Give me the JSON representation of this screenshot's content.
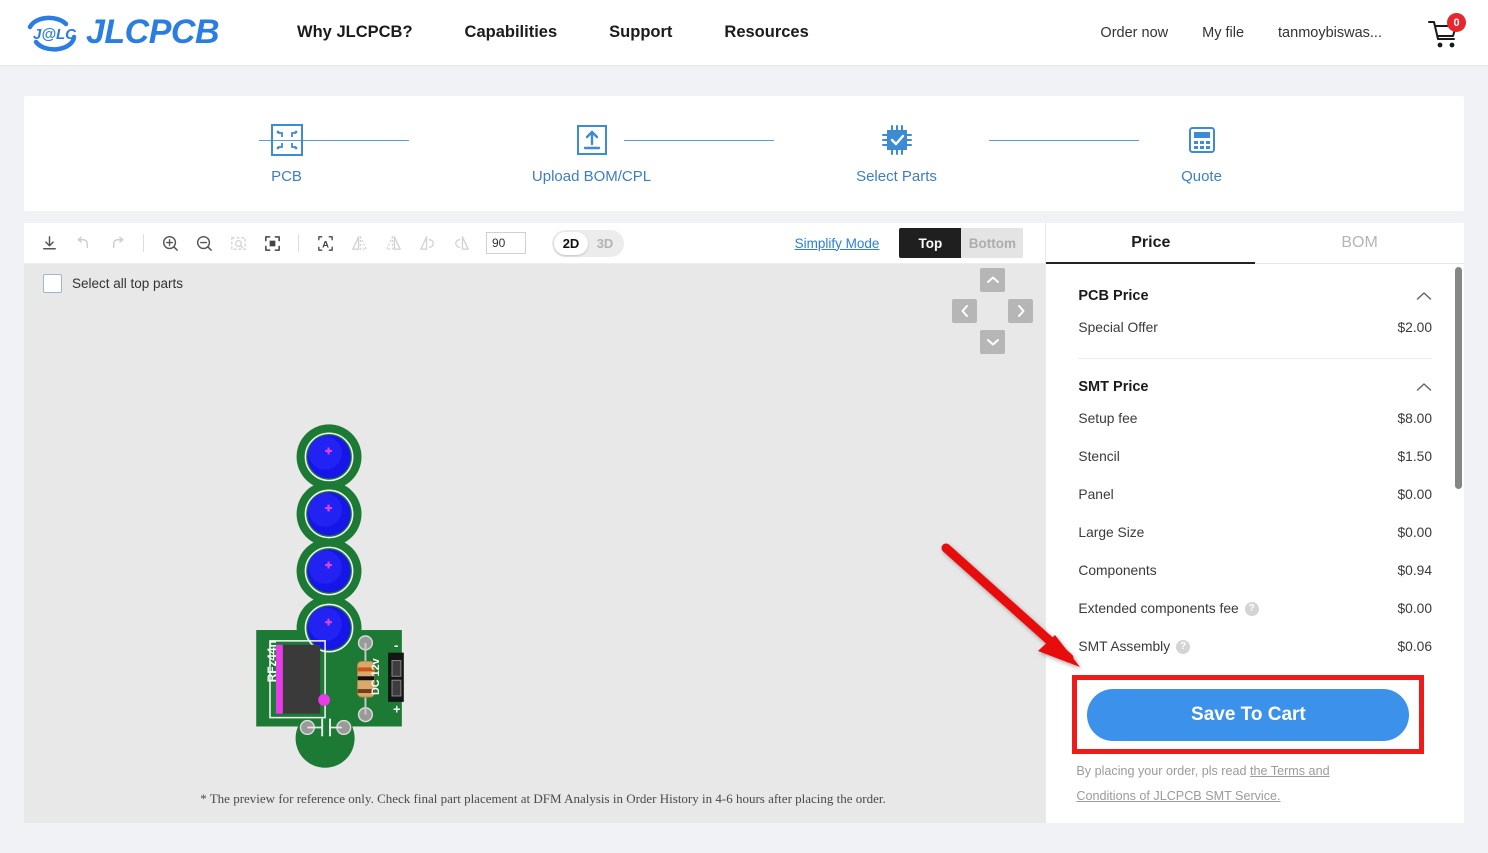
{
  "header": {
    "logo_mark": "jlc-logo-icon",
    "logo_text": "JLCPCB",
    "nav": [
      {
        "label": "Why JLCPCB?"
      },
      {
        "label": "Capabilities"
      },
      {
        "label": "Support"
      },
      {
        "label": "Resources"
      }
    ],
    "right_links": [
      {
        "label": "Order now"
      },
      {
        "label": "My file"
      },
      {
        "label": "tanmoybiswas..."
      }
    ],
    "cart_icon": "shopping-cart-icon",
    "cart_count": "0",
    "cart_badge_color": "#e8262d",
    "brand_color": "#2a7de1"
  },
  "stepper": {
    "steps": [
      {
        "label": "PCB",
        "icon": "pcb-board-icon"
      },
      {
        "label": "Upload BOM/CPL",
        "icon": "upload-icon"
      },
      {
        "label": "Select Parts",
        "icon": "chip-check-icon"
      },
      {
        "label": "Quote",
        "icon": "calculator-icon"
      }
    ],
    "line_color": "#5b9bd5",
    "label_color": "#3d7ebf"
  },
  "toolbar": {
    "buttons": [
      {
        "name": "download-icon",
        "title": "Download",
        "enabled": true
      },
      {
        "name": "undo-icon",
        "title": "Undo",
        "enabled": false
      },
      {
        "name": "redo-icon",
        "title": "Redo",
        "enabled": false
      },
      {
        "name": "zoom-in-icon",
        "title": "Zoom in",
        "enabled": true
      },
      {
        "name": "zoom-out-icon",
        "title": "Zoom out",
        "enabled": true
      },
      {
        "name": "zoom-area-icon",
        "title": "Zoom area",
        "enabled": false
      },
      {
        "name": "fit-screen-icon",
        "title": "Fit to screen",
        "enabled": true
      },
      {
        "name": "text-label-icon",
        "title": "Toggle labels",
        "enabled": true
      },
      {
        "name": "flip-horizontal-icon",
        "title": "Flip horizontal",
        "enabled": false
      },
      {
        "name": "flip-vertical-icon",
        "title": "Flip vertical",
        "enabled": false
      },
      {
        "name": "rotate-ccw-icon",
        "title": "Rotate counter-clockwise",
        "enabled": false
      },
      {
        "name": "rotate-cw-icon",
        "title": "Rotate clockwise",
        "enabled": false
      }
    ],
    "rotation_value": "90",
    "dimension_toggle": {
      "options": [
        "2D",
        "3D"
      ],
      "selected": "2D"
    },
    "simplify_mode_label": "Simplify Mode",
    "side_toggle": {
      "options": [
        "Top",
        "Bottom"
      ],
      "selected": "Top"
    }
  },
  "canvas": {
    "select_all_label": "Select all top parts",
    "select_all_checked": false,
    "pan_controls": [
      "pan-up-icon",
      "pan-down-icon",
      "pan-left-icon",
      "pan-right-icon"
    ],
    "footnote": "* The preview for reference only. Check final part placement at DFM Analysis in Order History in 4-6 hours after placing the order.",
    "board_silkscreen": [
      {
        "text": "RFz44n"
      },
      {
        "text": "DC 12v"
      },
      {
        "text": "-"
      },
      {
        "text": "+"
      }
    ],
    "board_color": "#1c7a34",
    "pad_color": "#1414e0"
  },
  "right_panel": {
    "tabs": [
      {
        "label": "Price",
        "active": true
      },
      {
        "label": "BOM",
        "active": false
      }
    ],
    "groups": [
      {
        "title": "PCB Price",
        "collapse_icon": "chevron-up-icon",
        "rows": [
          {
            "label": "Special Offer",
            "value": "$2.00",
            "help": false
          }
        ]
      },
      {
        "title": "SMT Price",
        "collapse_icon": "chevron-up-icon",
        "rows": [
          {
            "label": "Setup fee",
            "value": "$8.00",
            "help": false
          },
          {
            "label": "Stencil",
            "value": "$1.50",
            "help": false
          },
          {
            "label": "Panel",
            "value": "$0.00",
            "help": false
          },
          {
            "label": "Large Size",
            "value": "$0.00",
            "help": false
          },
          {
            "label": "Components",
            "value": "$0.94",
            "help": false
          },
          {
            "label": "Extended components fee",
            "value": "$0.00",
            "help": true
          },
          {
            "label": "SMT Assembly",
            "value": "$0.06",
            "help": true
          }
        ]
      }
    ],
    "save_button_label": "Save To Cart",
    "save_button_color": "#3c91ea",
    "highlight_color": "#ee1b1b",
    "terms_prefix": "By placing your order, pls read ",
    "terms_link": "the Terms and Conditions of JLCPCB SMT Service."
  },
  "annotation": {
    "arrow_color": "#e81010",
    "arrow_name": "red-pointer-arrow"
  }
}
